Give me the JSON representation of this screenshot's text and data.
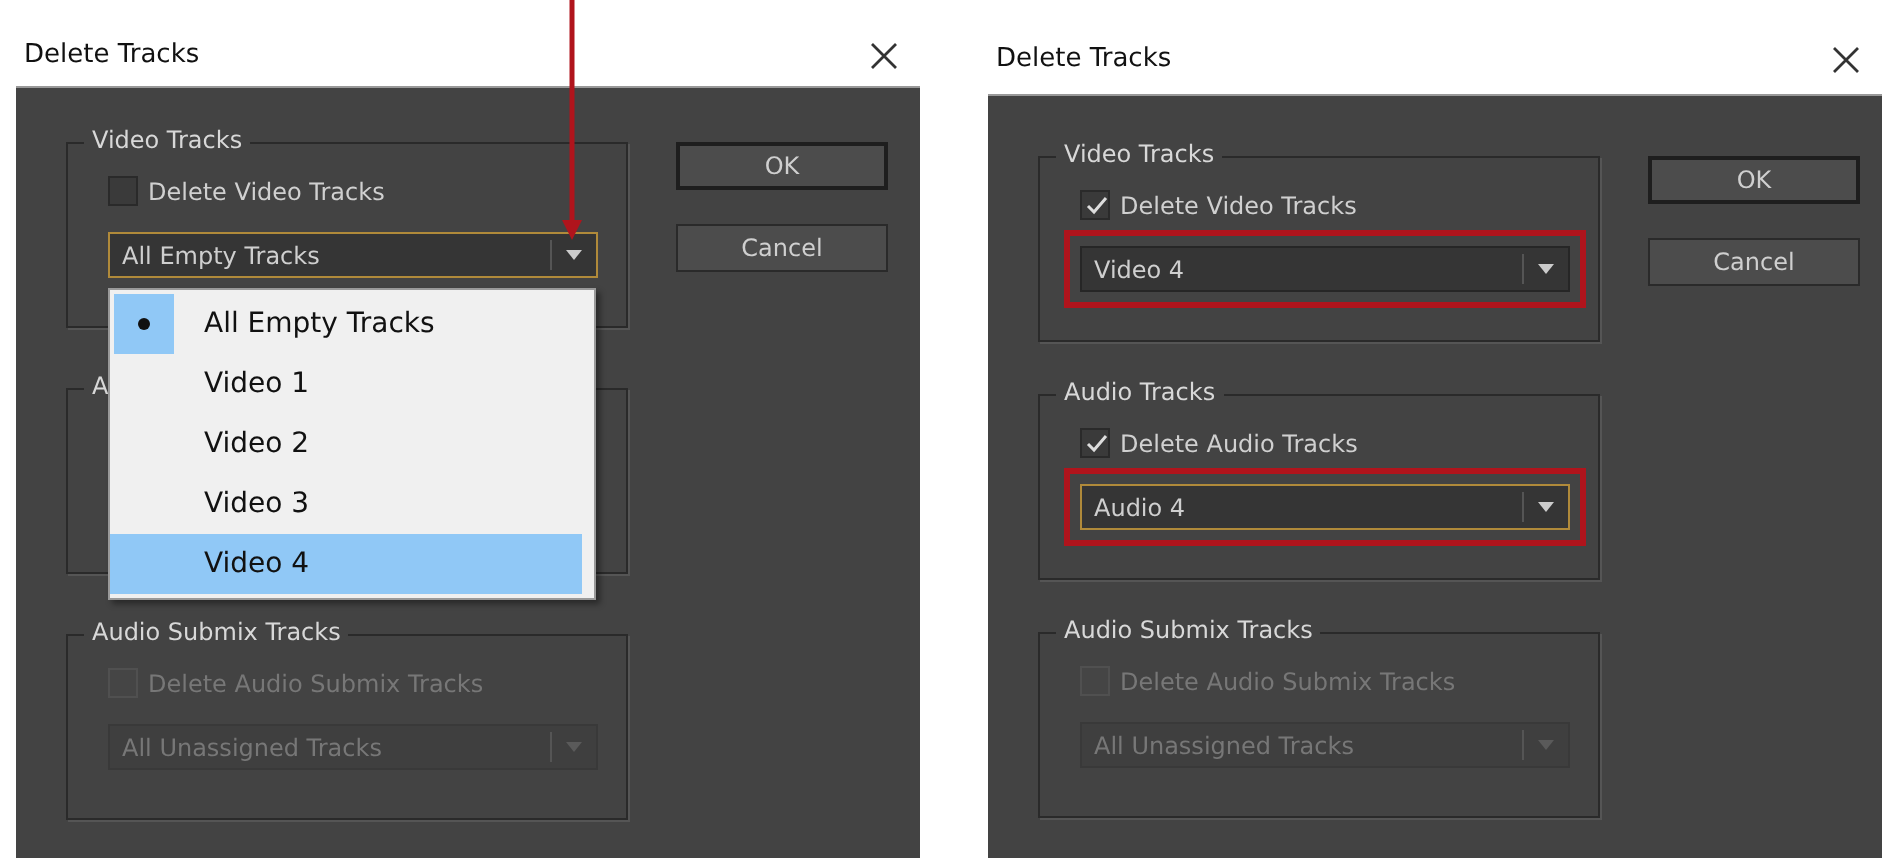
{
  "dialogs": [
    {
      "title": "Delete Tracks",
      "pointer_arrow": true,
      "groups": [
        {
          "title": "Video Tracks",
          "checkbox": {
            "label": "Delete Video Tracks",
            "checked": false,
            "disabled": false
          },
          "dropdown": {
            "value": "All Empty Tracks",
            "disabled": false,
            "focused": true,
            "options": [
              {
                "label": "All Empty Tracks",
                "selected": true,
                "hovered": false
              },
              {
                "label": "Video 1",
                "selected": false,
                "hovered": false
              },
              {
                "label": "Video 2",
                "selected": false,
                "hovered": false
              },
              {
                "label": "Video 3",
                "selected": false,
                "hovered": false
              },
              {
                "label": "Video 4",
                "selected": false,
                "hovered": true
              }
            ]
          }
        },
        {
          "title": "A"
        },
        {
          "title": "Audio Submix Tracks",
          "checkbox": {
            "label": "Delete Audio Submix Tracks",
            "checked": false,
            "disabled": true
          },
          "dropdown": {
            "value": "All Unassigned Tracks",
            "disabled": true,
            "focused": false
          }
        }
      ],
      "buttons": [
        "OK",
        "Cancel"
      ]
    },
    {
      "title": "Delete Tracks",
      "groups": [
        {
          "title": "Video Tracks",
          "checkbox": {
            "label": "Delete Video Tracks",
            "checked": true,
            "disabled": false
          },
          "dropdown": {
            "value": "Video 4",
            "disabled": false,
            "focused": false,
            "highlighted": true
          }
        },
        {
          "title": "Audio Tracks",
          "checkbox": {
            "label": "Delete Audio Tracks",
            "checked": true,
            "disabled": false
          },
          "dropdown": {
            "value": "Audio 4",
            "disabled": false,
            "focused": true,
            "highlighted": true
          }
        },
        {
          "title": "Audio Submix Tracks",
          "checkbox": {
            "label": "Delete Audio Submix Tracks",
            "checked": false,
            "disabled": true
          },
          "dropdown": {
            "value": "All Unassigned Tracks",
            "disabled": true,
            "focused": false
          }
        }
      ],
      "buttons": [
        "OK",
        "Cancel"
      ]
    }
  ]
}
